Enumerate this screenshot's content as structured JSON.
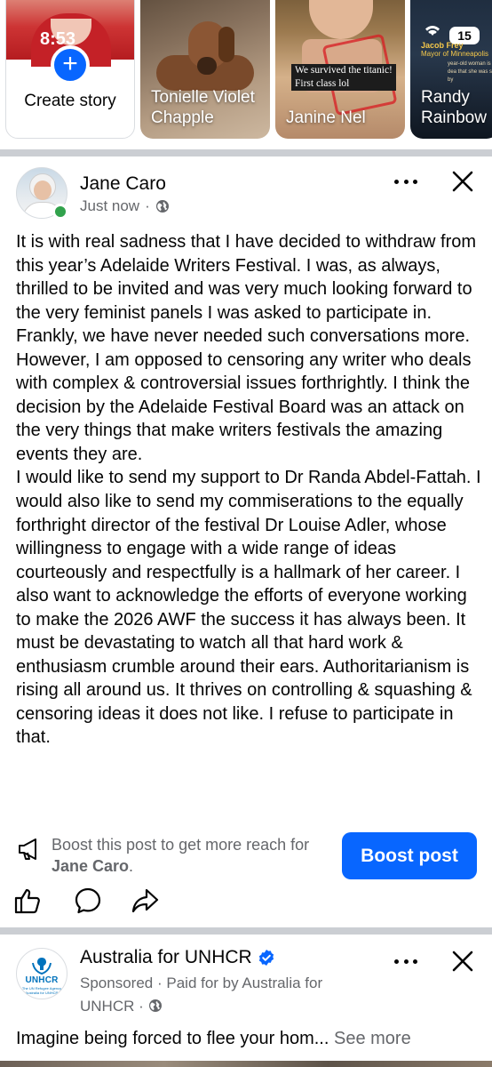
{
  "stories": [
    {
      "label": "Create story",
      "type": "create",
      "time_overlay": "8:53",
      "plus_icon": "plus-icon"
    },
    {
      "label": "Tonielle Violet Chapple",
      "type": "friend"
    },
    {
      "label": "Janine Nel",
      "type": "friend",
      "caption_lines": [
        "We survived the titanic!",
        "First class lol"
      ]
    },
    {
      "label": "Randy Rainbow",
      "type": "friend",
      "overlay_badge": "15",
      "overlay_name": "Jacob Frey",
      "overlay_role": "Mayor of Minneapolis",
      "overlay_news": "year-old woman is dea that she was shot by"
    }
  ],
  "post": {
    "author": "Jane Caro",
    "timestamp": "Just now",
    "separator": "·",
    "audience_icon": "globe-icon",
    "online": true,
    "paragraphs": [
      "It is with real sadness that I have decided to withdraw from this year’s Adelaide Writers Festival. I was, as always, thrilled to be invited and was very much looking forward to the very feminist panels I was asked to participate in. Frankly, we have never needed such conversations more.",
      "However, I am opposed to censoring any writer who deals with complex & controversial issues forthrightly. I think the decision by the Adelaide Festival Board was an attack on the very things that make writers festivals the amazing events they are.",
      "I would like to send my support to Dr Randa Abdel-Fattah. I would also like to send my commiserations to the equally forthright director of the festival Dr Louise Adler, whose willingness to engage with a wide range of ideas courteously and respectfully is a hallmark of her career. I also want to acknowledge the efforts of everyone working to make the 2026 AWF the success it has always been. It must be devastating to watch all that hard work & enthusiasm crumble around their ears. Authoritarianism is rising all around us. It thrives on controlling & squashing & censoring ideas it does not like. I refuse to participate in that."
    ],
    "boost_text_prefix": "Boost this post to get more reach for ",
    "boost_text_name": "Jane Caro",
    "boost_text_suffix": ".",
    "boost_button": "Boost post",
    "actions": [
      "like-icon",
      "comment-icon",
      "share-icon"
    ]
  },
  "sponsored": {
    "advertiser": "Australia for UNHCR",
    "verified": true,
    "logo_text": "UNHCR",
    "logo_subtext": "The UN Refugee Agency Australia for UNHCR",
    "label": "Sponsored",
    "separator": "·",
    "paid_by": "Paid for by Australia for UNHCR",
    "audience_icon": "globe-icon",
    "body": "Imagine being forced to flee your hom...",
    "see_more": "See more"
  },
  "colors": {
    "accent": "#0866ff",
    "secondary_text": "#65676b",
    "online": "#31a24c",
    "divider": "#cbced3"
  }
}
